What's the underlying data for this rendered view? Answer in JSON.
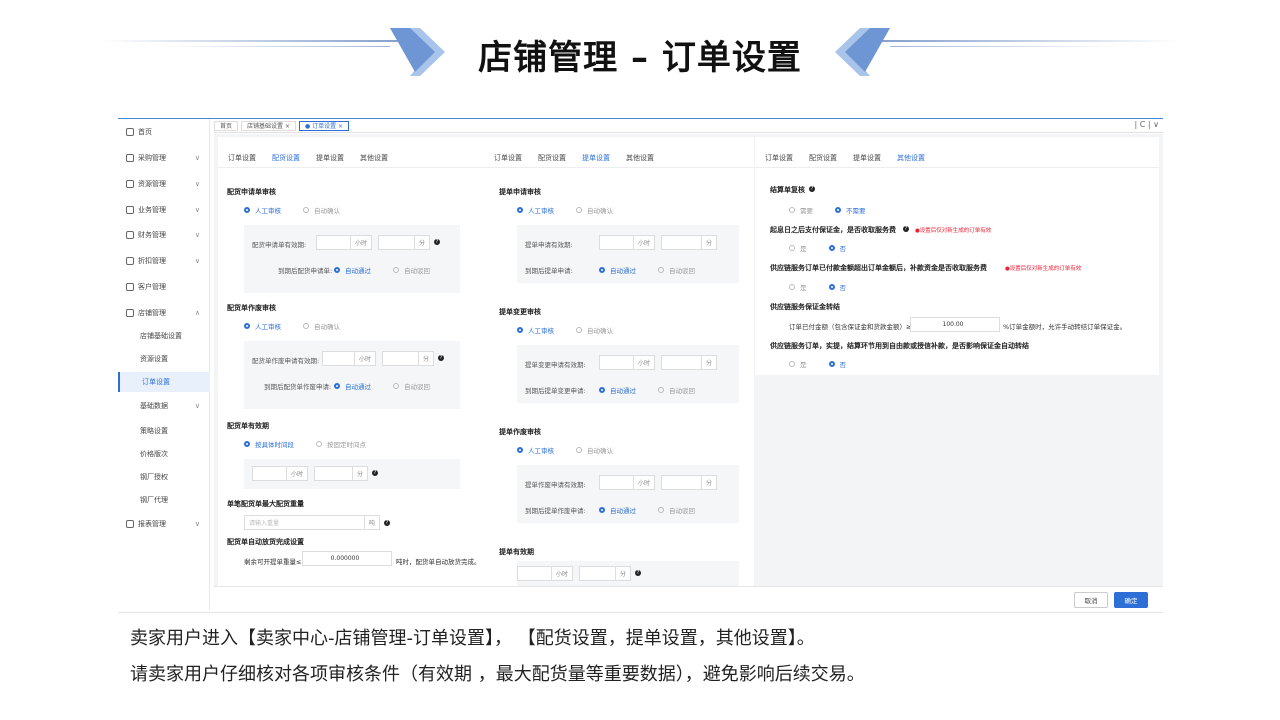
{
  "slide": {
    "title": "店铺管理 – 订单设置",
    "caption_line1": "卖家用户进入【卖家中心-店铺管理-订单设置】，  【配货设置，提单设置，其他设置】。",
    "caption_line2": "请卖家用户仔细核对各项审核条件（有效期 ，最大配货量等重要数据），避免影响后续交易。"
  },
  "sidebar": {
    "items": [
      {
        "label": "首页",
        "icon": "home-icon"
      },
      {
        "label": "采购管理",
        "icon": "cart-icon"
      },
      {
        "label": "资源管理",
        "icon": "box-icon"
      },
      {
        "label": "业务管理",
        "icon": "briefcase-icon"
      },
      {
        "label": "财务管理",
        "icon": "finance-icon"
      },
      {
        "label": "折扣管理",
        "icon": "discount-icon"
      },
      {
        "label": "客户管理",
        "icon": "users-icon"
      },
      {
        "label": "店铺管理",
        "icon": "store-icon"
      }
    ],
    "store_subitems": [
      "店铺基础设置",
      "资源设置",
      "订单设置",
      "基础数据",
      "策略设置",
      "价格版次",
      "钢厂授权",
      "钢厂代理"
    ],
    "last_item": {
      "label": "报表管理",
      "icon": "report-icon"
    },
    "active_sub": "订单设置"
  },
  "topbar": {
    "crumbs": [
      "首页",
      "店铺基础设置 ×",
      "● 订单设置 ×"
    ],
    "controls": "| C | ∨"
  },
  "tabs": [
    "订单设置",
    "配货设置",
    "提单设置",
    "其他设置"
  ],
  "panel1": {
    "sec1": {
      "title": "配货申请单审核",
      "opt_manual": "人工审核",
      "opt_auto": "自动确认",
      "valid_label": "配货申请单有效期:",
      "unit_hour": "小时",
      "unit_min": "分",
      "expire_label": "到期后配货申请单:",
      "expire_pass": "自动通过",
      "expire_reject": "自动驳回"
    },
    "sec2": {
      "title": "配货单作废审核",
      "opt_manual": "人工审核",
      "opt_auto": "自动确认",
      "valid_label": "配货单作废申请有效期:",
      "unit_hour": "小时",
      "unit_min": "分",
      "expire_label": "到期后配货单作废申请:",
      "expire_pass": "自动通过",
      "expire_reject": "自动驳回"
    },
    "sec3": {
      "title": "配货单有效期",
      "opt_a": "按具体时间段",
      "opt_b": "按固定时间点",
      "unit_hour": "小时",
      "unit_min": "分"
    },
    "sec4": {
      "title": "单笔配货单最大配货重量",
      "placeholder": "请输入重量",
      "unit": "吨"
    },
    "sec5": {
      "title": "配货单自动放货完成设置",
      "label": "剩余可开提单重量≤",
      "value": "0.000000",
      "tail": "吨时，配货单自动放货完成。"
    }
  },
  "panel2": {
    "sec1": {
      "title": "提单申请审核",
      "opt_manual": "人工审核",
      "opt_auto": "自动确认",
      "valid_label": "提单申请有效期:",
      "unit_hour": "小时",
      "unit_min": "分",
      "expire_label": "到期后提单申请:",
      "expire_pass": "自动通过",
      "expire_reject": "自动驳回"
    },
    "sec2": {
      "title": "提单变更审核",
      "opt_manual": "人工审核",
      "opt_auto": "自动确认",
      "valid_label": "提单变更申请有效期:",
      "unit_hour": "小时",
      "unit_min": "分",
      "expire_label": "到期后提单变更申请:",
      "expire_pass": "自动通过",
      "expire_reject": "自动驳回"
    },
    "sec3": {
      "title": "提单作废审核",
      "opt_manual": "人工审核",
      "opt_auto": "自动确认",
      "valid_label": "提单作废申请有效期:",
      "unit_hour": "小时",
      "unit_min": "分",
      "expire_label": "到期后提单作废申请:",
      "expire_pass": "自动通过",
      "expire_reject": "自动驳回"
    },
    "sec4": {
      "title": "提单有效期",
      "unit_hour": "小时",
      "unit_min": "分"
    }
  },
  "panel3": {
    "q1": {
      "title": "结算单复核",
      "yes": "需要",
      "no": "不需要"
    },
    "q2": {
      "title": "起息日之后支付保证金，是否收取服务费",
      "hint": "●设置后仅对新生成的订单有效",
      "yes": "是",
      "no": "否"
    },
    "q3": {
      "title": "供应链服务订单已付款金额超出订单金额后，补款资金是否收取服务费",
      "hint": "●设置后仅对新生成的订单有效",
      "yes": "是",
      "no": "否"
    },
    "q4": {
      "title": "供应链服务保证金转结",
      "label": "订单已付金额（包含保证金和货款金额）≥",
      "value": "100.00",
      "tail": "%订单金额时，允许手动转结订单保证金。"
    },
    "q5": {
      "title": "供应链服务订单，实提，结算环节用到自由款或授信补款，是否影响保证金自动转结",
      "yes": "是",
      "no": "否"
    }
  },
  "footer": {
    "cancel": "取消",
    "ok": "确定"
  },
  "colors": {
    "accent": "#2d6fd6",
    "hint": "#e22233"
  }
}
